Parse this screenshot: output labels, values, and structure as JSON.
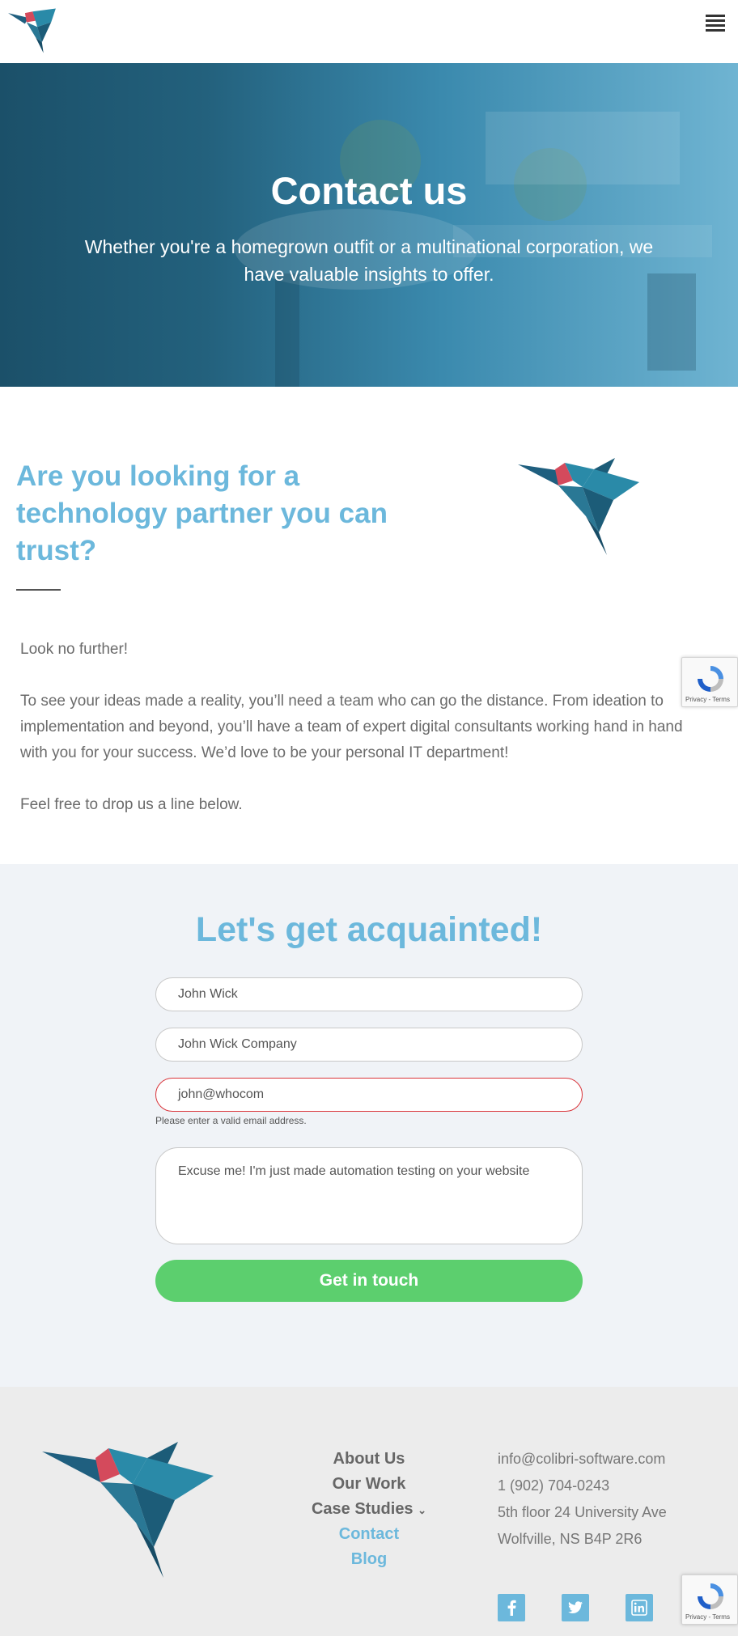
{
  "header": {
    "logo": "colibri-logo",
    "menu_icon": "hamburger-icon"
  },
  "hero": {
    "title": "Contact us",
    "subtitle": "Whether you're a homegrown outfit or a multinational corporation, we have valuable insights to offer."
  },
  "intro": {
    "heading": "Are you looking for a technology partner you can trust?",
    "paragraphs": [
      "Look no further!",
      "To see your ideas made a reality, you’ll need a team who can go the distance. From ideation to implementation and beyond, you’ll have a team of expert digital consultants working hand in hand with you for your success. We’d love to be your personal IT department!",
      "Feel free to drop us a line below."
    ]
  },
  "recaptcha": {
    "terms": "Privacy - Terms"
  },
  "form": {
    "title": "Let's get acquainted!",
    "name_value": "John Wick",
    "company_value": "John Wick Company",
    "email_value": "john@whocom",
    "email_error": "Please enter a valid email address.",
    "message_value": "Excuse me! I'm just made automation testing on your website",
    "submit_label": "Get in touch"
  },
  "footer": {
    "nav": [
      {
        "label": "About Us"
      },
      {
        "label": "Our Work"
      },
      {
        "label": "Case Studies"
      },
      {
        "label": "Contact"
      },
      {
        "label": "Blog"
      }
    ],
    "contact": {
      "email": "info@colibri-software.com",
      "phone": "1 (902) 704-0243",
      "address1": "5th floor 24 University Ave",
      "address2": "Wolfville, NS B4P 2R6"
    },
    "social": [
      "facebook-icon",
      "twitter-icon",
      "linkedin-icon"
    ]
  },
  "colors": {
    "accent": "#6cb8dc",
    "button": "#5ccf6e",
    "hero_dark": "#1b5069",
    "error": "#d9343a"
  }
}
